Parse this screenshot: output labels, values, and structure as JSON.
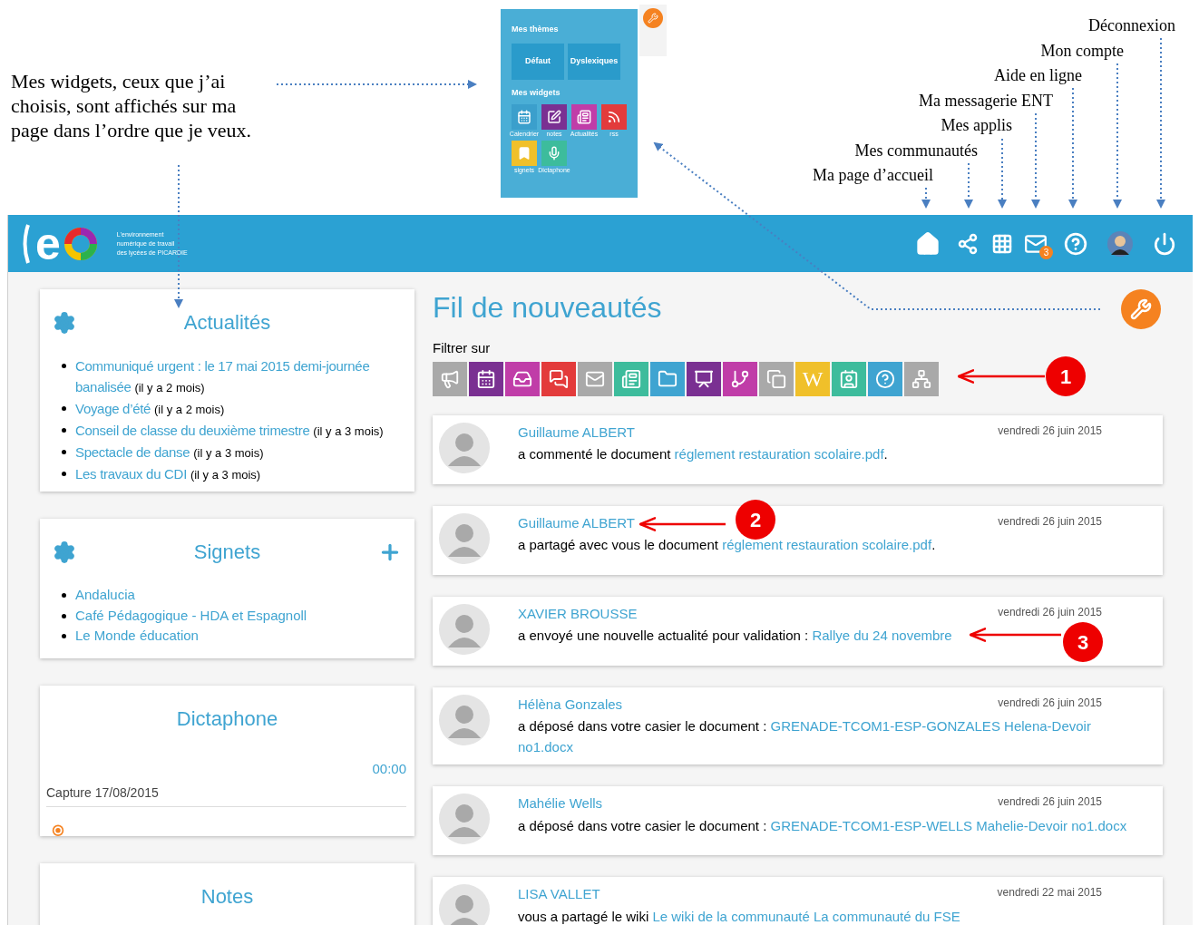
{
  "annotations": {
    "widgets_note": "Mes widgets, ceux que j’ai choisis, sont affichés sur ma page dans l’ordre que je veux.",
    "menu_labels": [
      "Déconnexion",
      "Mon compte",
      "Aide en ligne",
      "Ma messagerie ENT",
      "Mes applis",
      "Mes communautés",
      "Ma page d’accueil"
    ],
    "markers": [
      "1",
      "2",
      "3"
    ]
  },
  "theme_panel": {
    "themes_title": "Mes thèmes",
    "themes": [
      "Défaut",
      "Dyslexiques"
    ],
    "widgets_title": "Mes widgets",
    "widgets": [
      {
        "label": "Calendrier",
        "kind": "calendar",
        "color": "#3b9fcc"
      },
      {
        "label": "notes",
        "kind": "notes",
        "color": "#7a3092"
      },
      {
        "label": "Actualités",
        "kind": "news",
        "color": "#c03da8"
      },
      {
        "label": "rss",
        "kind": "rss",
        "color": "#e33b3b"
      },
      {
        "label": "signets",
        "kind": "bookmark",
        "color": "#f0c02a"
      },
      {
        "label": "Dictaphone",
        "kind": "mic",
        "color": "#3dbc9c"
      }
    ]
  },
  "header": {
    "logo": {
      "letter": "e",
      "tagline": [
        "L'environnement",
        "numérique de travail",
        "des lycées de PICARDIE"
      ]
    },
    "mail_badge": "3"
  },
  "widgets": {
    "news": {
      "title": "Actualités",
      "items": [
        {
          "title": "Communiqué urgent : le 17 mai 2015 demi-journée banalisée",
          "age": "(il y a 2 mois)"
        },
        {
          "title": "Voyage d’été",
          "age": "(il y a 2 mois)"
        },
        {
          "title": "Conseil de classe du deuxième trimestre",
          "age": "(il y a 3 mois)"
        },
        {
          "title": "Spectacle de danse",
          "age": "(il y a 3 mois)"
        },
        {
          "title": "Les travaux du CDI",
          "age": "(il y a 3 mois)"
        }
      ]
    },
    "bookmarks": {
      "title": "Signets",
      "items": [
        "Andalucia",
        "Café Pédagogique - HDA et Espagnoll",
        "Le Monde éducation"
      ]
    },
    "dictaphone": {
      "title": "Dictaphone",
      "time": "00:00",
      "capture": "Capture 17/08/2015"
    },
    "notes": {
      "title": "Notes"
    }
  },
  "feed": {
    "title": "Fil de nouveautés",
    "filter_label": "Filtrer sur",
    "filters": [
      {
        "kind": "megaphone",
        "color": "#a9a9a9"
      },
      {
        "kind": "calendar",
        "color": "#7a3092"
      },
      {
        "kind": "inbox",
        "color": "#c03da8"
      },
      {
        "kind": "chat",
        "color": "#e33b3b"
      },
      {
        "kind": "mail",
        "color": "#a9a9a9"
      },
      {
        "kind": "news",
        "color": "#3dbc9c"
      },
      {
        "kind": "folder",
        "color": "#3fa4d1"
      },
      {
        "kind": "board",
        "color": "#7a3092"
      },
      {
        "kind": "tree",
        "color": "#c03da8"
      },
      {
        "kind": "copy",
        "color": "#a9a9a9"
      },
      {
        "kind": "letter",
        "letter": "W",
        "color": "#f0c02a"
      },
      {
        "kind": "contact",
        "color": "#3dbc9c"
      },
      {
        "kind": "help",
        "color": "#3fa4d1"
      },
      {
        "kind": "network",
        "color": "#a9a9a9"
      }
    ],
    "items": [
      {
        "name": "Guillaume ALBERT",
        "date": "vendredi 26 juin 2015",
        "text": "a commenté le document",
        "link": "réglement restauration scolaire.pdf",
        "after": "."
      },
      {
        "name": "Guillaume ALBERT",
        "date": "vendredi 26 juin 2015",
        "text": "a partagé avec vous le document",
        "link": "réglement restauration scolaire.pdf",
        "after": "."
      },
      {
        "name": "XAVIER BROUSSE",
        "date": "vendredi 26 juin 2015",
        "text": "a envoyé une nouvelle actualité pour validation :",
        "link": "Rallye du 24 novembre"
      },
      {
        "name": "Hélèna Gonzales",
        "date": "vendredi 26 juin 2015",
        "text": "a déposé dans votre casier le document :",
        "link": "GRENADE-TCOM1-ESP-GONZALES Helena-Devoir no1.docx"
      },
      {
        "name": "Mahélie Wells",
        "date": "vendredi 26 juin 2015",
        "text": "a déposé dans votre casier le document :",
        "link": "GRENADE-TCOM1-ESP-WELLS Mahelie-Devoir no1.docx"
      },
      {
        "name": "LISA VALLET",
        "date": "vendredi 22 mai 2015",
        "text": "vous a partagé le wiki",
        "link": "Le wiki de la communauté La communauté du FSE"
      }
    ]
  }
}
